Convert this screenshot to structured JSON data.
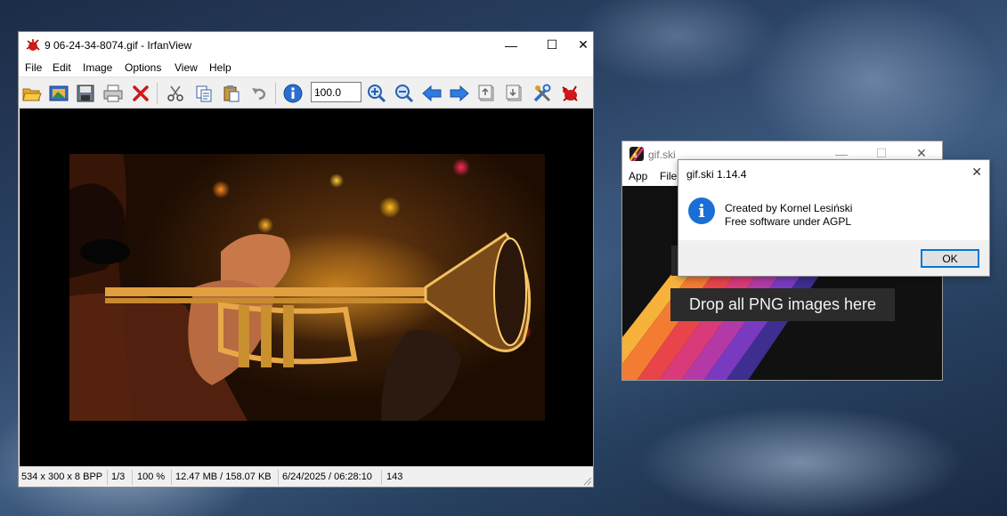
{
  "irfanview": {
    "title": "9 06-24-34-8074.gif - IrfanView",
    "menu": [
      "File",
      "Edit",
      "Image",
      "Options",
      "View",
      "Help"
    ],
    "zoom_value": "100.0",
    "status": {
      "dimensions": "534 x 300 x 8 BPP",
      "frame": "1/3",
      "zoom": "100 %",
      "size": "12.47 MB / 158.07 KB",
      "datetime": "6/24/2025 / 06:28:10",
      "extra": "143"
    },
    "caption": {
      "minimize": "—",
      "maximize": "☐",
      "close": "✕"
    }
  },
  "gifski": {
    "title": "gif.ski",
    "menu": [
      "App",
      "File"
    ],
    "drop_label": "Drop all PNG images here",
    "caption": {
      "minimize": "—",
      "maximize": "☐",
      "close": "✕"
    }
  },
  "about_dialog": {
    "title": "gif.ski 1.14.4",
    "line1": "Created by Kornel Lesiński",
    "line2": "Free software under AGPL",
    "ok_label": "OK",
    "close": "✕",
    "info_glyph": "i"
  },
  "colors": {
    "accent": "#0078d7",
    "info_icon": "#1a6fd6"
  }
}
